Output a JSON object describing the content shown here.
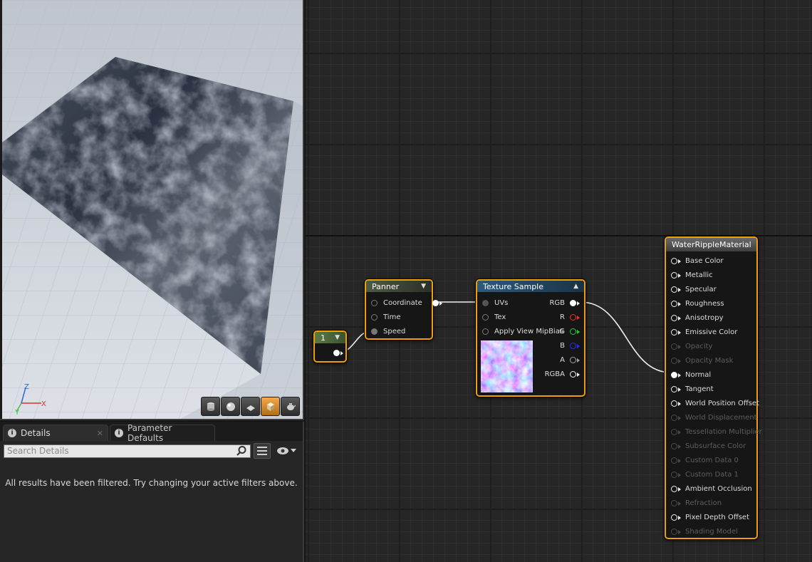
{
  "viewport": {
    "toolbar": [
      "cylinder-icon",
      "sphere-icon",
      "plane-icon",
      "cube-icon",
      "teapot-icon"
    ],
    "active_tool": "cube-icon",
    "axis_labels": {
      "x": "X",
      "y": "Y",
      "z": "Z"
    }
  },
  "details": {
    "tabs": [
      {
        "label": "Details",
        "active": true
      },
      {
        "label": "Parameter Defaults",
        "active": false
      }
    ],
    "search_placeholder": "Search Details",
    "filter_message": "All results have been filtered. Try changing your active filters above."
  },
  "graph": {
    "constant_node": {
      "value": "1"
    },
    "panner_node": {
      "title": "Panner",
      "inputs": [
        "Coordinate",
        "Time",
        "Speed"
      ]
    },
    "texture_node": {
      "title": "Texture Sample",
      "inputs": [
        "UVs",
        "Tex",
        "Apply View MipBias"
      ],
      "outputs": [
        "RGB",
        "R",
        "G",
        "B",
        "A",
        "RGBA"
      ]
    },
    "material_node": {
      "title": "WaterRippleMaterial",
      "inputs": [
        {
          "label": "Base Color",
          "enabled": true
        },
        {
          "label": "Metallic",
          "enabled": true
        },
        {
          "label": "Specular",
          "enabled": true
        },
        {
          "label": "Roughness",
          "enabled": true
        },
        {
          "label": "Anisotropy",
          "enabled": true
        },
        {
          "label": "Emissive Color",
          "enabled": true
        },
        {
          "label": "Opacity",
          "enabled": false
        },
        {
          "label": "Opacity Mask",
          "enabled": false
        },
        {
          "label": "Normal",
          "enabled": true,
          "connected": true
        },
        {
          "label": "Tangent",
          "enabled": true
        },
        {
          "label": "World Position Offset",
          "enabled": true
        },
        {
          "label": "World Displacement",
          "enabled": false
        },
        {
          "label": "Tessellation Multiplier",
          "enabled": false
        },
        {
          "label": "Subsurface Color",
          "enabled": false
        },
        {
          "label": "Custom Data 0",
          "enabled": false
        },
        {
          "label": "Custom Data 1",
          "enabled": false
        },
        {
          "label": "Ambient Occlusion",
          "enabled": true
        },
        {
          "label": "Refraction",
          "enabled": false
        },
        {
          "label": "Pixel Depth Offset",
          "enabled": true
        },
        {
          "label": "Shading Model",
          "enabled": false
        }
      ]
    }
  }
}
